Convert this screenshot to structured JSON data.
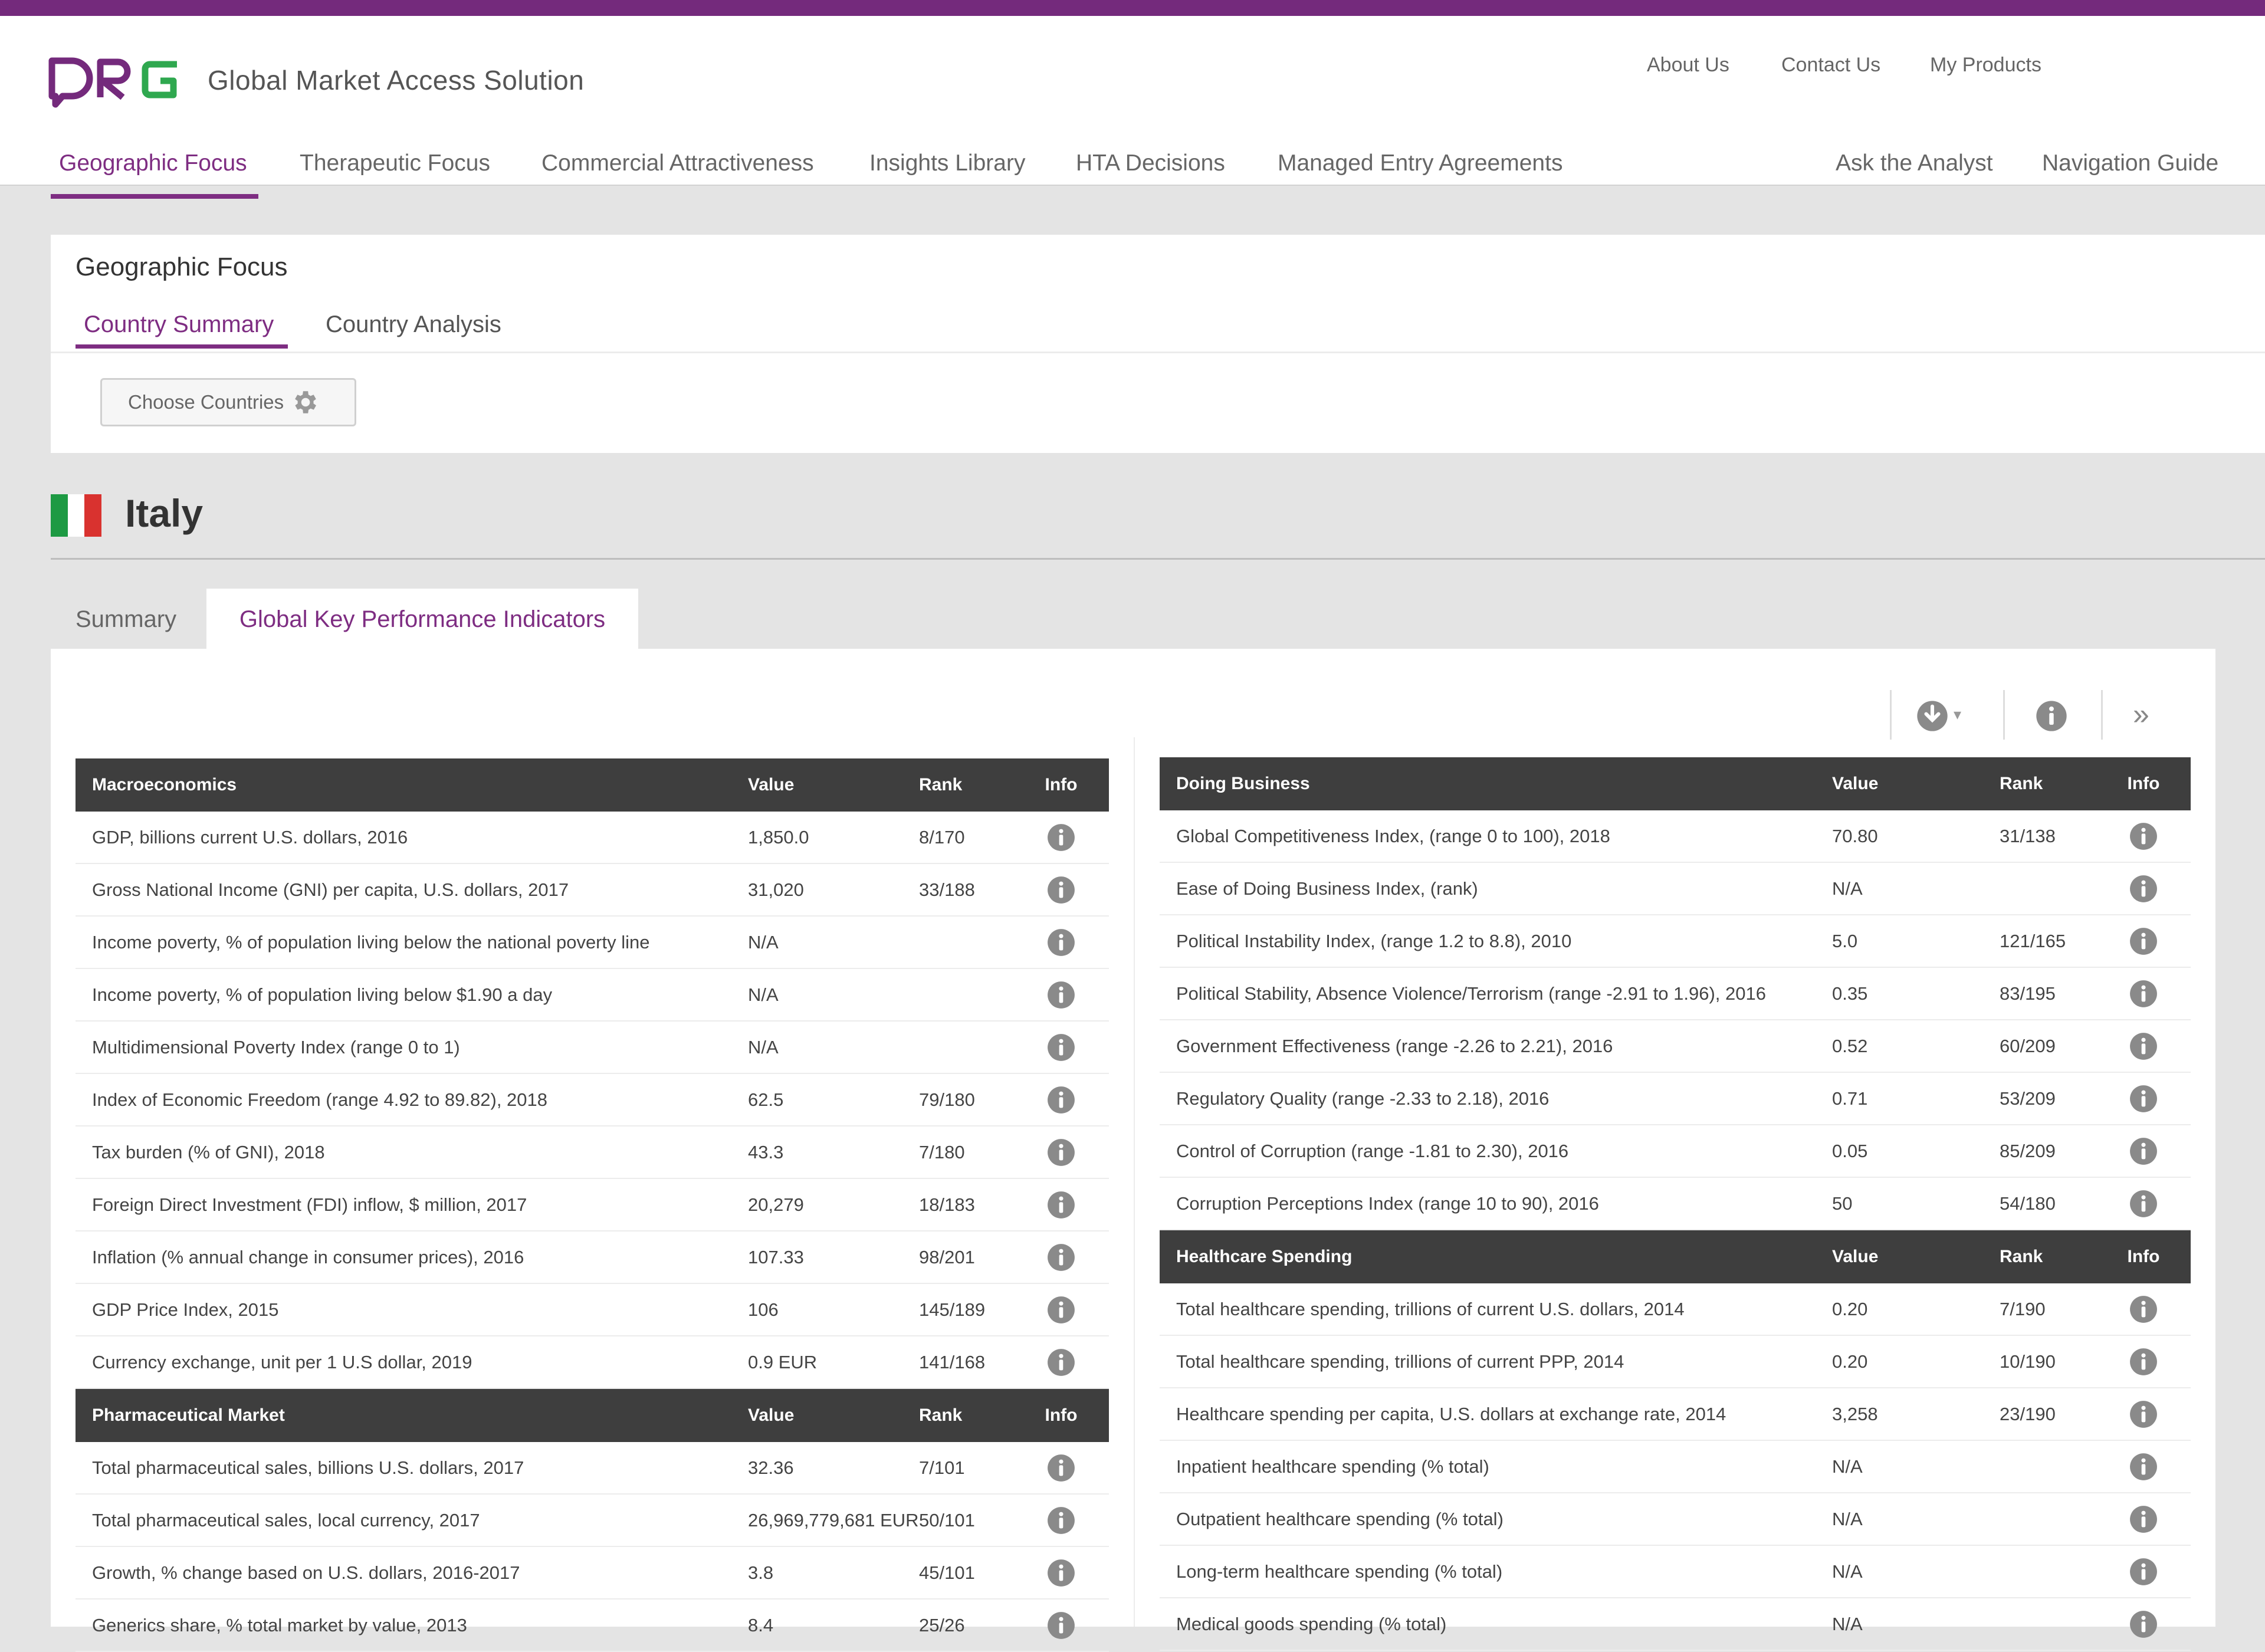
{
  "header": {
    "logo_text": "DRG",
    "app_title": "Global Market Access Solution",
    "utility_links": [
      "About Us",
      "Contact Us",
      "My Products"
    ],
    "nav": {
      "primary": [
        "Geographic Focus",
        "Therapeutic Focus",
        "Commercial Attractiveness",
        "Insights Library",
        "HTA Decisions",
        "Managed Entry Agreements"
      ],
      "secondary": [
        "Ask the Analyst",
        "Navigation Guide"
      ],
      "active": "Geographic Focus"
    }
  },
  "geo_section": {
    "title": "Geographic Focus",
    "tabs": [
      "Country Summary",
      "Country Analysis"
    ],
    "active_tab": "Country Summary",
    "choose_button": "Choose Countries"
  },
  "country": {
    "name": "Italy",
    "flag_colors": [
      "#1d9a43",
      "#ffffff",
      "#d9322f"
    ],
    "tabs": [
      "Summary",
      "Global Key Performance Indicators"
    ],
    "active_tab": "Global Key Performance Indicators"
  },
  "colors": {
    "accent": "#7e2d82",
    "topbar": "#742a7c",
    "logo_accent": "#2fa84f",
    "table_header": "#3e3e3e"
  },
  "toolbar": {
    "icons": [
      "download-icon",
      "info-icon",
      "double-chevron-right-icon"
    ],
    "download_caret": "▾",
    "expand_glyph": "»"
  },
  "tables": {
    "macro": {
      "title": "Macroeconomics",
      "columns": [
        "Value",
        "Rank",
        "Info"
      ],
      "rows": [
        {
          "label": "GDP, billions current U.S. dollars, 2016",
          "value": "1,850.0",
          "rank": "8/170"
        },
        {
          "label": "Gross National Income (GNI) per capita, U.S. dollars, 2017",
          "value": "31,020",
          "rank": "33/188"
        },
        {
          "label": "Income poverty, % of population living below the national poverty line",
          "value": "N/A",
          "rank": ""
        },
        {
          "label": "Income poverty, % of population living below $1.90 a day",
          "value": "N/A",
          "rank": ""
        },
        {
          "label": "Multidimensional Poverty Index (range 0 to 1)",
          "value": "N/A",
          "rank": ""
        },
        {
          "label": "Index of Economic Freedom (range 4.92 to 89.82), 2018",
          "value": "62.5",
          "rank": "79/180"
        },
        {
          "label": "Tax burden (% of GNI), 2018",
          "value": "43.3",
          "rank": "7/180"
        },
        {
          "label": "Foreign Direct Investment (FDI) inflow, $ million, 2017",
          "value": "20,279",
          "rank": "18/183"
        },
        {
          "label": "Inflation (% annual change in consumer prices), 2016",
          "value": "107.33",
          "rank": "98/201"
        },
        {
          "label": "GDP Price Index, 2015",
          "value": "106",
          "rank": "145/189"
        },
        {
          "label": "Currency exchange, unit per 1 U.S dollar, 2019",
          "value": "0.9 EUR",
          "rank": "141/168"
        }
      ]
    },
    "pharma": {
      "title": "Pharmaceutical Market",
      "columns": [
        "Value",
        "Rank",
        "Info"
      ],
      "rows": [
        {
          "label": "Total pharmaceutical sales, billions U.S. dollars, 2017",
          "value": "32.36",
          "rank": "7/101"
        },
        {
          "label": "Total pharmaceutical sales, local currency, 2017",
          "value": "26,969,779,681 EUR",
          "rank": "50/101"
        },
        {
          "label": "Growth, % change based on U.S. dollars, 2016-2017",
          "value": "3.8",
          "rank": "45/101"
        },
        {
          "label": "Generics share, % total market by value, 2013",
          "value": "8.4",
          "rank": "25/26"
        }
      ]
    },
    "business": {
      "title": "Doing Business",
      "columns": [
        "Value",
        "Rank",
        "Info"
      ],
      "rows": [
        {
          "label": "Global Competitiveness Index, (range 0 to 100), 2018",
          "value": "70.80",
          "rank": "31/138"
        },
        {
          "label": "Ease of Doing Business Index, (rank)",
          "value": "N/A",
          "rank": ""
        },
        {
          "label": "Political Instability Index, (range 1.2 to 8.8), 2010",
          "value": "5.0",
          "rank": "121/165"
        },
        {
          "label": "Political Stability, Absence Violence/Terrorism (range -2.91 to 1.96), 2016",
          "value": "0.35",
          "rank": "83/195"
        },
        {
          "label": "Government Effectiveness (range -2.26 to 2.21), 2016",
          "value": "0.52",
          "rank": "60/209"
        },
        {
          "label": "Regulatory Quality (range -2.33 to 2.18), 2016",
          "value": "0.71",
          "rank": "53/209"
        },
        {
          "label": "Control of Corruption (range -1.81 to 2.30), 2016",
          "value": "0.05",
          "rank": "85/209"
        },
        {
          "label": "Corruption Perceptions Index (range 10 to 90), 2016",
          "value": "50",
          "rank": "54/180"
        }
      ]
    },
    "healthcare": {
      "title": "Healthcare Spending",
      "columns": [
        "Value",
        "Rank",
        "Info"
      ],
      "rows": [
        {
          "label": "Total healthcare spending, trillions of current U.S. dollars, 2014",
          "value": "0.20",
          "rank": "7/190"
        },
        {
          "label": "Total healthcare spending, trillions of current PPP, 2014",
          "value": "0.20",
          "rank": "10/190"
        },
        {
          "label": "Healthcare spending per capita, U.S. dollars at exchange rate, 2014",
          "value": "3,258",
          "rank": "23/190"
        },
        {
          "label": "Inpatient healthcare spending (% total)",
          "value": "N/A",
          "rank": ""
        },
        {
          "label": "Outpatient healthcare spending (% total)",
          "value": "N/A",
          "rank": ""
        },
        {
          "label": "Long-term healthcare spending (% total)",
          "value": "N/A",
          "rank": ""
        },
        {
          "label": "Medical goods spending (% total)",
          "value": "N/A",
          "rank": ""
        }
      ]
    }
  }
}
